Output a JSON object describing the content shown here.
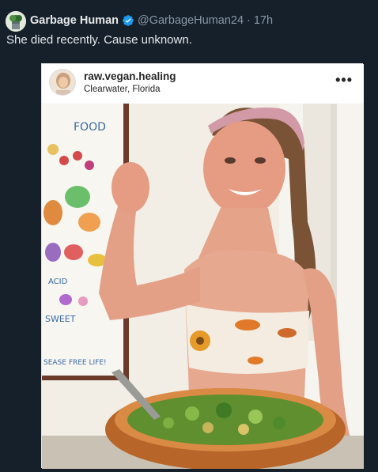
{
  "tweet": {
    "display_name": "Garbage Human",
    "handle": "@GarbageHuman24",
    "separator": "·",
    "timestamp": "17h",
    "verified_icon": "verified-badge-icon",
    "text": "She died recently. Cause unknown."
  },
  "embedded_post": {
    "username": "raw.vegan.healing",
    "location": "Clearwater, Florida",
    "more_label": "•••",
    "poster_words": [
      "FOOD",
      "ACID",
      "SWEET",
      "SEASE FREE LIFE!"
    ]
  },
  "colors": {
    "background": "#15202b",
    "primary_text": "#e7e9ea",
    "secondary_text": "#8b98a5",
    "verified": "#1d9bf0"
  }
}
